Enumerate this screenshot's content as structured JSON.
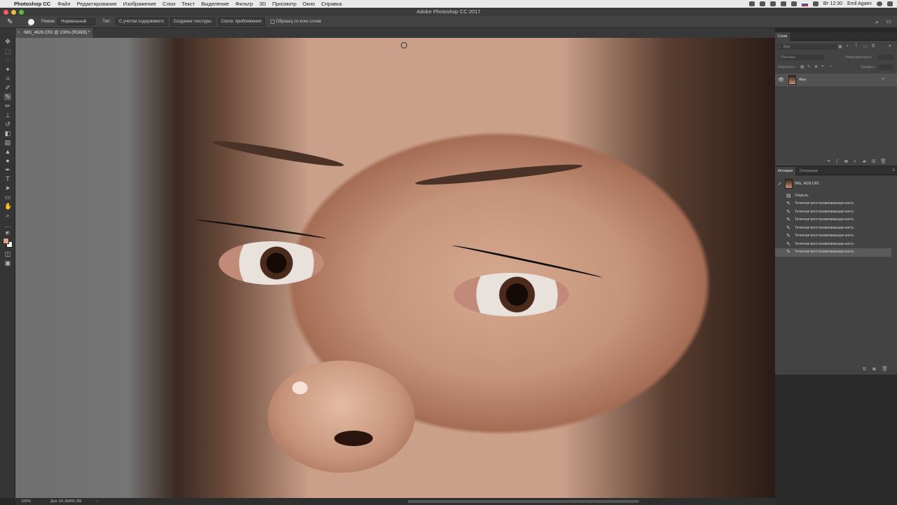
{
  "menubar": {
    "app_name": "Photoshop CC",
    "items": [
      "Файл",
      "Редактирование",
      "Изображение",
      "Слои",
      "Текст",
      "Выделение",
      "Фильтр",
      "3D",
      "Просмотр",
      "Окно",
      "Справка"
    ],
    "clock": "Вт 12:30",
    "user": "Emil Agaev"
  },
  "window": {
    "title": "Adobe Photoshop CC 2017"
  },
  "options_bar": {
    "brush_size": "19",
    "mode_label": "Режим:",
    "mode_value": "Нормальный",
    "type_label": "Тип:",
    "type_buttons": [
      "С учетом содержимого",
      "Создание текстуры",
      "Соотв. приближения"
    ],
    "sample_all_label": "Образец со всех слоев"
  },
  "document": {
    "tab_label": "IMG_4628.CR2 @ 100% (RGB/8) *"
  },
  "status_bar": {
    "zoom": "100%",
    "doc_size": "Док: 65,3M/65,3M"
  },
  "layers_panel": {
    "tab": "Слои",
    "search_placeholder": "Вид",
    "blend_mode": "Обычные",
    "opacity_label": "Непрозрачность:",
    "lock_label": "Закрепить:",
    "fill_label": "Заливка:",
    "layer_name": "Фон"
  },
  "history_panel": {
    "tabs": [
      "История",
      "Операции"
    ],
    "snapshot": "IMG_4628.CR2",
    "items": [
      "Открыть",
      "Точечная восстанавливающая кисть",
      "Точечная восстанавливающая кисть",
      "Точечная восстанавливающая кисть",
      "Точечная восстанавливающая кисть",
      "Точечная восстанавливающая кисть",
      "Точечная восстанавливающая кисть",
      "Точечная восстанавливающая кисть"
    ]
  },
  "colors": {
    "foreground": "#d9a48c",
    "background": "#ffffff",
    "accent": "#4a90e2"
  }
}
